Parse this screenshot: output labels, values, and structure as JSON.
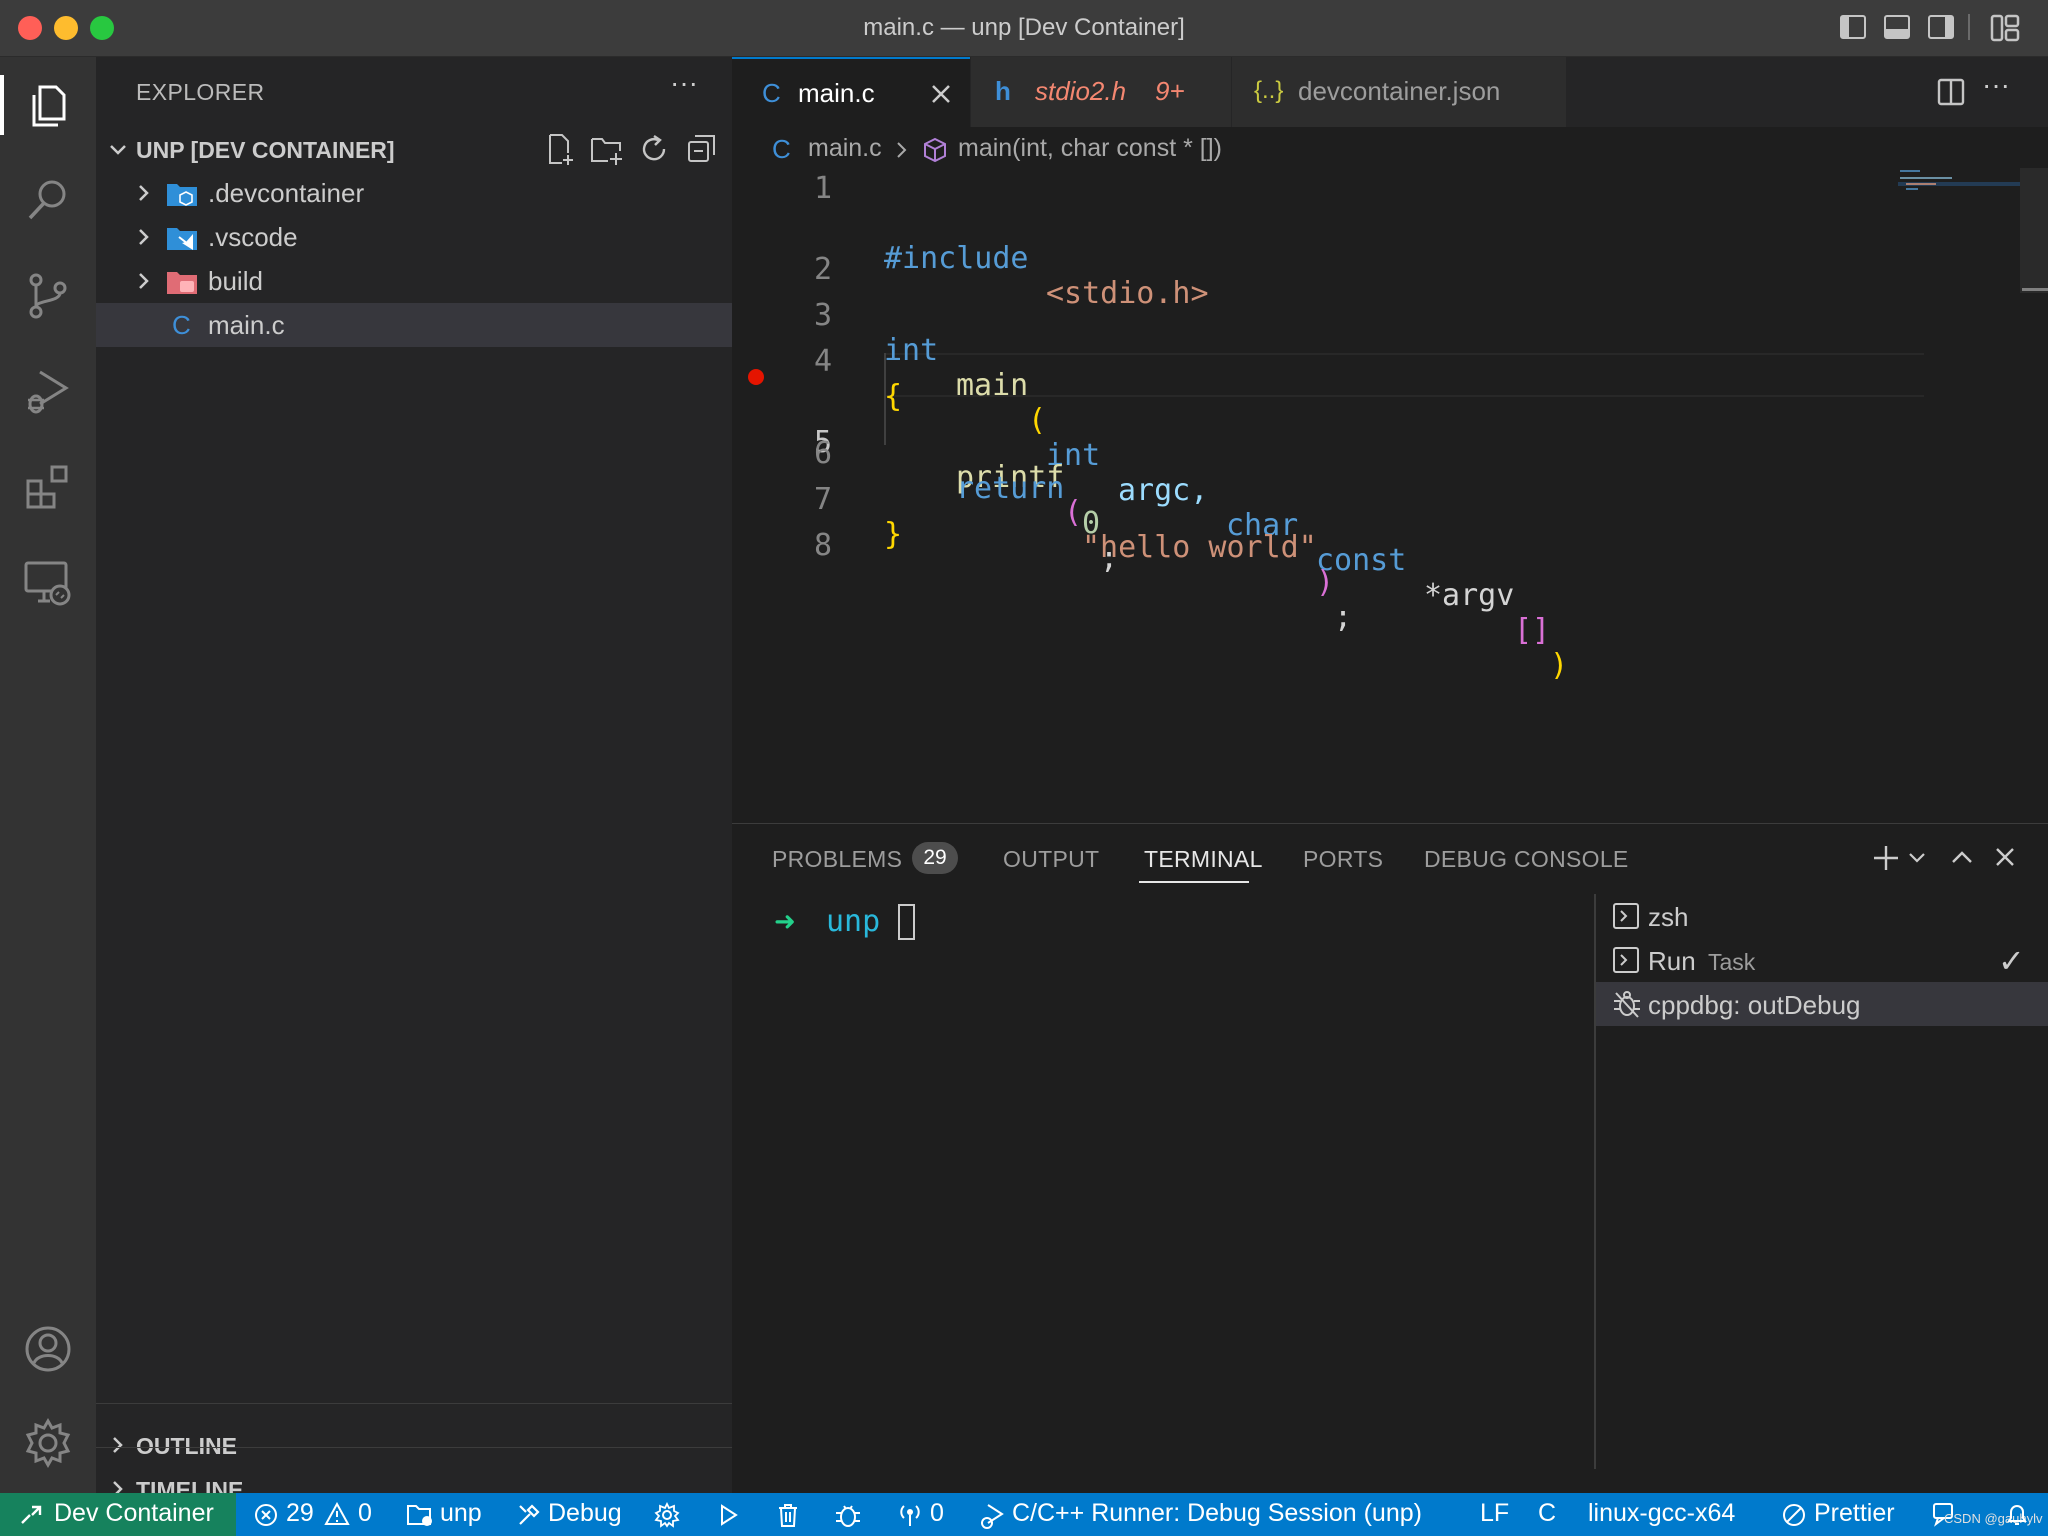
{
  "window": {
    "title": "main.c — unp [Dev Container]"
  },
  "sidebar": {
    "header": "EXPLORER",
    "more_icon": "ellipsis-icon",
    "root_label": "UNP [DEV CONTAINER]",
    "items": [
      {
        "label": ".devcontainer",
        "type": "folder",
        "icon": "folder-devcontainer-icon",
        "color": "#2f8fd8"
      },
      {
        "label": ".vscode",
        "type": "folder",
        "icon": "folder-vscode-icon",
        "color": "#2f8fd8"
      },
      {
        "label": "build",
        "type": "folder",
        "icon": "folder-build-icon",
        "color": "#e06c75"
      },
      {
        "label": "main.c",
        "type": "file",
        "icon": "c-file-icon",
        "glyph": "C"
      }
    ],
    "outline_label": "OUTLINE",
    "timeline_label": "TIMELINE"
  },
  "tabs": [
    {
      "glyph": "C",
      "label": "main.c",
      "active": true
    },
    {
      "glyph": "h",
      "label": "stdio2.h",
      "badge": "9+"
    },
    {
      "glyph": "{..}",
      "label": "devcontainer.json"
    }
  ],
  "breadcrumb": {
    "file_glyph": "C",
    "file": "main.c",
    "symbol": "main(int, char const * [])"
  },
  "code": {
    "line_numbers": [
      "1",
      "2",
      "3",
      "4",
      "5",
      "6",
      "7",
      "8"
    ],
    "breakpoint_line": "5",
    "l1_directive": "#include",
    "l1_header": "<stdio.h>",
    "l3_int": "int",
    "l3_main": "main",
    "l3_paren_open": "(",
    "l3_int2": "int",
    "l3_argc": "argc,",
    "l3_char": "char",
    "l3_const": "const",
    "l3_argv": "*argv",
    "l3_brackets": "[]",
    "l3_paren_close": ")",
    "l4": "{",
    "l5_fn": "printf",
    "l5_open": "(",
    "l5_str": "\"hello world\"",
    "l5_close": ")",
    "l5_semi": ";",
    "l6_kw": "return",
    "l6_num": "0",
    "l6_semi": ";",
    "l7": "}"
  },
  "panel": {
    "tabs": [
      "PROBLEMS",
      "OUTPUT",
      "TERMINAL",
      "PORTS",
      "DEBUG CONSOLE"
    ],
    "problems_count": "29",
    "active_tab": "TERMINAL",
    "terminal": {
      "arrow": "➜",
      "cwd": "unp"
    },
    "terminals": [
      {
        "name": "zsh",
        "icon": "terminal-icon"
      },
      {
        "name": "Run",
        "suffix": "Task",
        "icon": "terminal-icon",
        "check": "✓"
      },
      {
        "name": "cppdbg: outDebug",
        "icon": "debug-icon",
        "selected": true
      }
    ]
  },
  "statusbar": {
    "remote": "Dev Container",
    "errors": "29",
    "warnings": "0",
    "folder": "unp",
    "debug": "Debug",
    "ports": "0",
    "runner": "C/C++ Runner: Debug Session (unp)",
    "eol": "LF",
    "language": "C",
    "config": "linux-gcc-x64",
    "prettier": "Prettier",
    "watermark": "CSDN @gauhylv"
  },
  "colors": {
    "accent": "#007acc",
    "remote_bg": "#16825d",
    "keyword": "#569cd6",
    "string": "#ce9178",
    "function": "#dcdcaa",
    "number": "#b5cea8",
    "bracket_gold": "#ffd700",
    "bracket_pink": "#da70d6",
    "breakpoint": "#e51400"
  }
}
